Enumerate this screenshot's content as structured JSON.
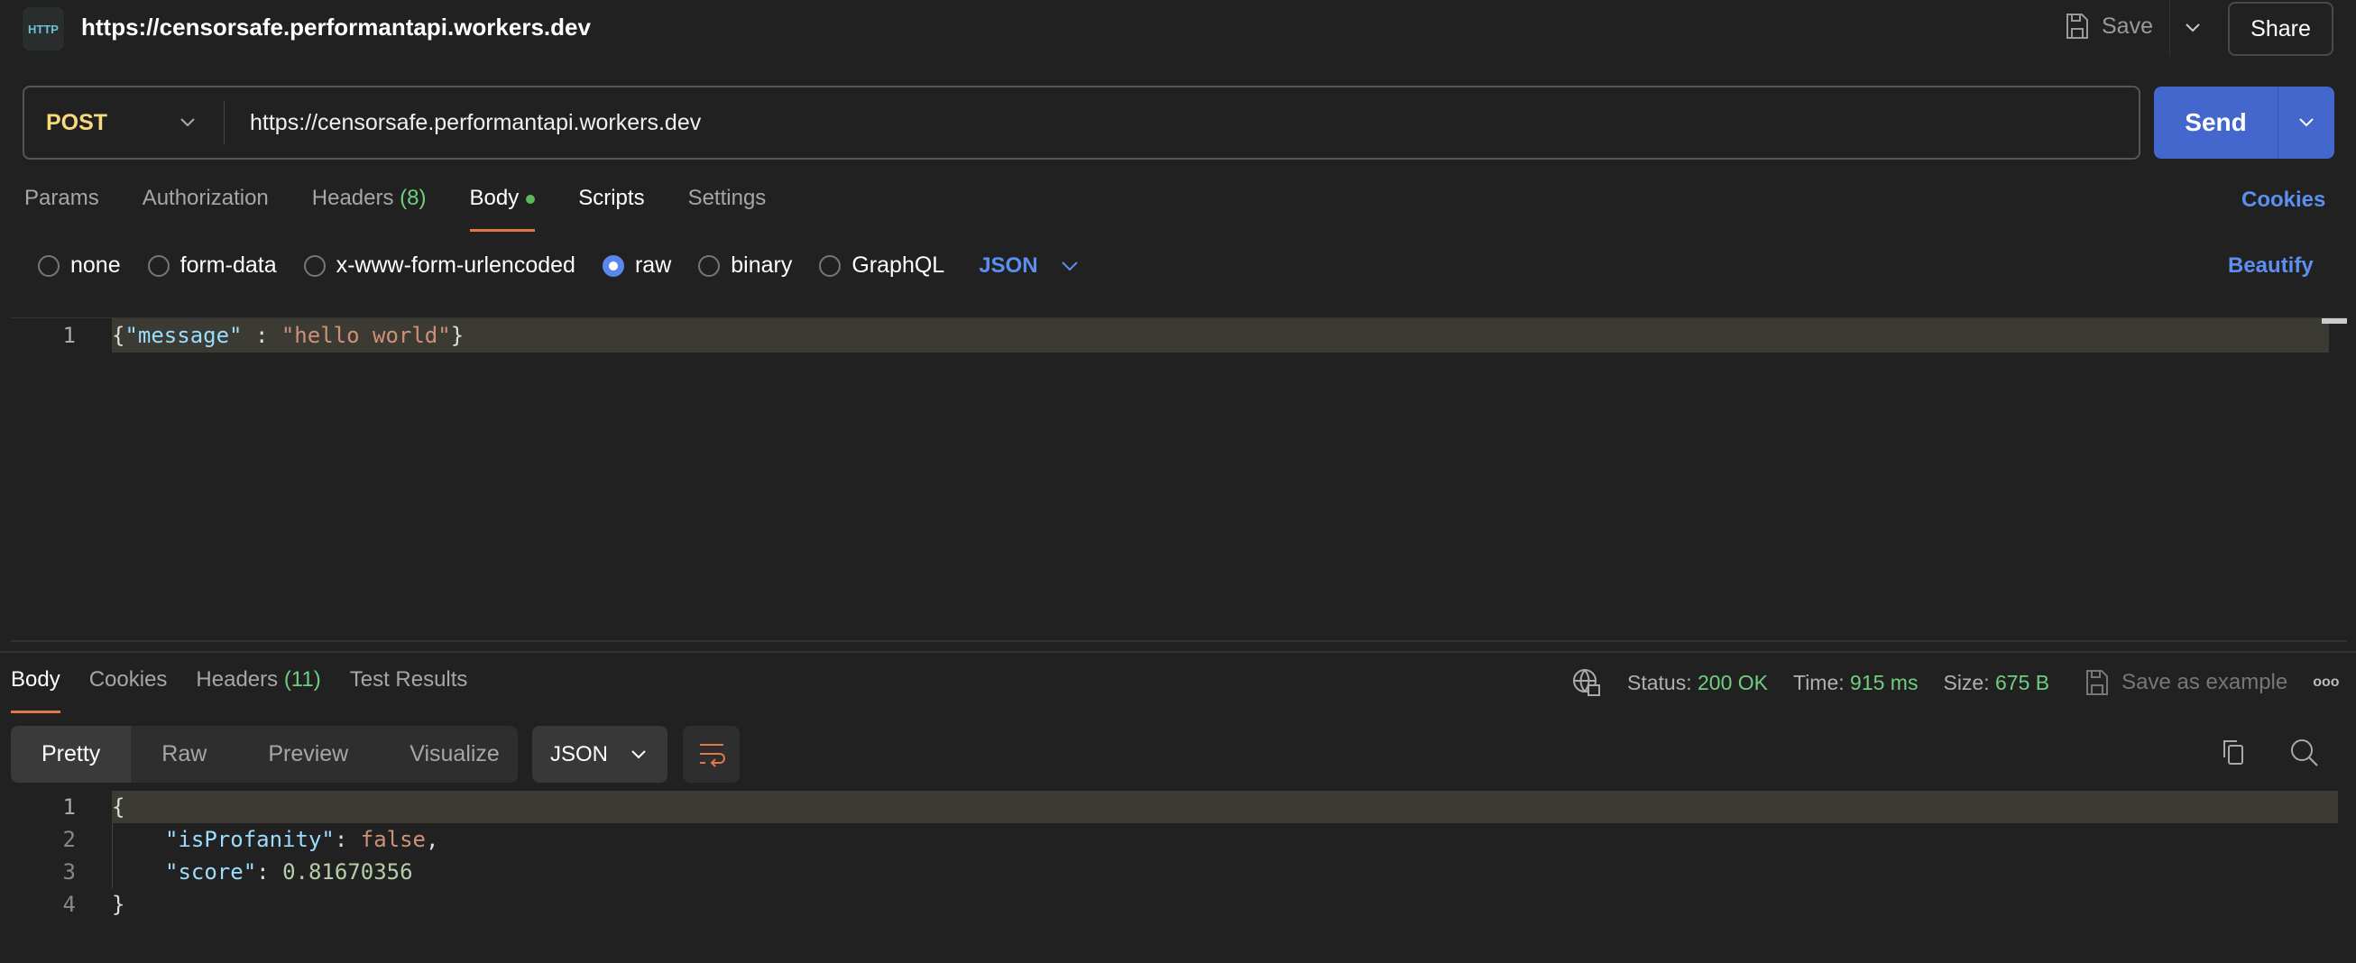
{
  "header": {
    "icon": "http-icon",
    "icon_text": "HTTP",
    "title": "https://censorsafe.performantapi.workers.dev",
    "save_label": "Save",
    "share_label": "Share"
  },
  "request": {
    "method": "POST",
    "url": "https://censorsafe.performantapi.workers.dev",
    "send_label": "Send"
  },
  "request_tabs": [
    {
      "label": "Params"
    },
    {
      "label": "Authorization"
    },
    {
      "label": "Headers",
      "count": "(8)"
    },
    {
      "label": "Body"
    },
    {
      "label": "Scripts"
    },
    {
      "label": "Settings"
    }
  ],
  "cookies_label": "Cookies",
  "body_types": [
    {
      "label": "none"
    },
    {
      "label": "form-data"
    },
    {
      "label": "x-www-form-urlencoded"
    },
    {
      "label": "raw",
      "selected": true
    },
    {
      "label": "binary"
    },
    {
      "label": "GraphQL"
    }
  ],
  "body_format": "JSON",
  "beautify_label": "Beautify",
  "request_body": {
    "line": "1",
    "brace_open": "{",
    "key": "\"message\"",
    "sep": " : ",
    "value": "\"hello world\"",
    "brace_close": "}"
  },
  "response_tabs": [
    {
      "label": "Body"
    },
    {
      "label": "Cookies"
    },
    {
      "label": "Headers",
      "count": "(11)"
    },
    {
      "label": "Test Results"
    }
  ],
  "response_meta": {
    "status_label": "Status:",
    "status": "200 OK",
    "time_label": "Time:",
    "time": "915 ms",
    "size_label": "Size:",
    "size": "675 B",
    "save_example_label": "Save as example",
    "more": "ooo"
  },
  "view_modes": [
    "Pretty",
    "Raw",
    "Preview",
    "Visualize"
  ],
  "response_format": "JSON",
  "response_body": {
    "lines": [
      "1",
      "2",
      "3",
      "4"
    ],
    "open": "{",
    "k1": "\"isProfanity\"",
    "v1": "false",
    "k2": "\"score\"",
    "v2": "0.81670356",
    "close": "}",
    "colon": ": ",
    "comma": ","
  },
  "colors": {
    "accent": "#4367cd",
    "tab_underline": "#e0784a",
    "status_ok": "#6fcf80",
    "link": "#5b8ff0"
  }
}
